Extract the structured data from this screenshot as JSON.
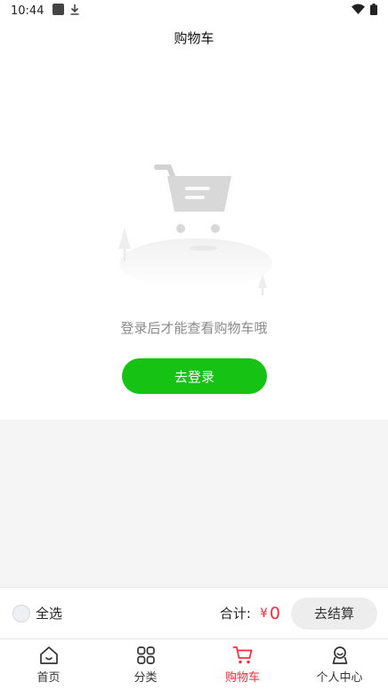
{
  "status": {
    "time": "10:44"
  },
  "header": {
    "title": "购物车"
  },
  "empty": {
    "message": "登录后才能查看购物车哦",
    "login_label": "去登录"
  },
  "summary": {
    "select_all": "全选",
    "total_label": "合计:",
    "currency": "¥",
    "total_value": "0",
    "checkout_label": "去结算"
  },
  "tabs": [
    {
      "label": "首页",
      "icon": "home-icon"
    },
    {
      "label": "分类",
      "icon": "category-icon"
    },
    {
      "label": "购物车",
      "icon": "cart-icon"
    },
    {
      "label": "个人中心",
      "icon": "user-icon"
    }
  ],
  "colors": {
    "accent_green": "#16c213",
    "accent_red": "#ff2a3c"
  }
}
